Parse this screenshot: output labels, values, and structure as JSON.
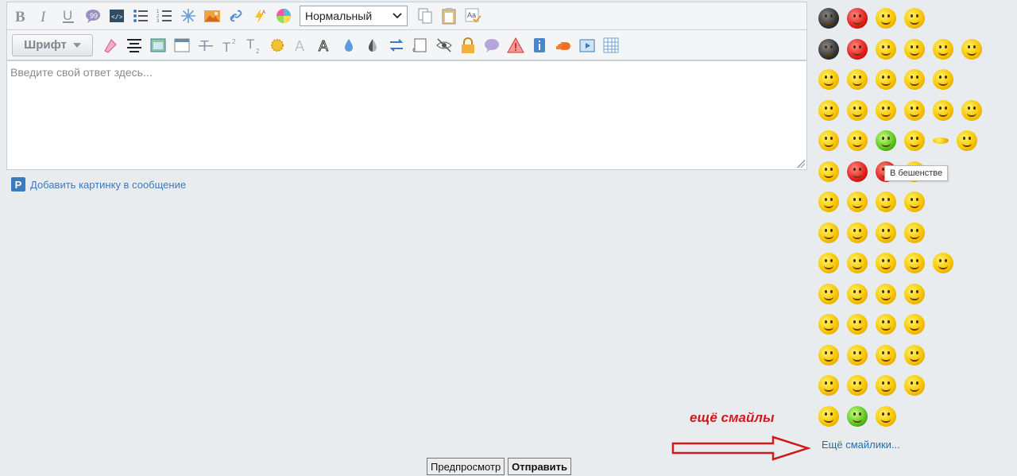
{
  "editor": {
    "placeholder": "Введите свой ответ здесь...",
    "format_select": "Нормальный",
    "font_button": "Шрифт",
    "toolbar_row1": [
      "bold-icon",
      "italic-icon",
      "underline-icon",
      "quote-icon",
      "code-icon",
      "bullet-list-icon",
      "numbered-list-icon",
      "spoiler-icon",
      "image-icon",
      "link-icon",
      "flash-icon",
      "color-icon"
    ],
    "toolbar_row1_right": [
      "copy-icon",
      "paste-icon",
      "spellcheck-icon"
    ],
    "toolbar_row2": [
      "highlight-icon",
      "align-center-icon",
      "table-icon",
      "box-icon",
      "strike-icon",
      "superscript-icon",
      "subscript-icon",
      "sun-icon",
      "shadow-text-icon",
      "outline-text-icon",
      "drop-icon",
      "drop-half-icon",
      "swap-icon",
      "scroll-icon",
      "eye-icon",
      "lock-icon",
      "comment-icon",
      "warning-icon",
      "info-icon",
      "soundcloud-icon",
      "media-icon",
      "grid-icon"
    ]
  },
  "add_image_link": "Добавить картинку в сообщение",
  "smilies": {
    "tooltip": "В бешенстве",
    "more_link": "Ещё смайлики..."
  },
  "annotation": "ещё смайлы",
  "buttons": {
    "preview": "Предпросмотр",
    "submit": "Отправить"
  },
  "colors": {
    "background": "#e9ecee",
    "link": "#3a7abf",
    "annotation": "#d11a1a"
  }
}
